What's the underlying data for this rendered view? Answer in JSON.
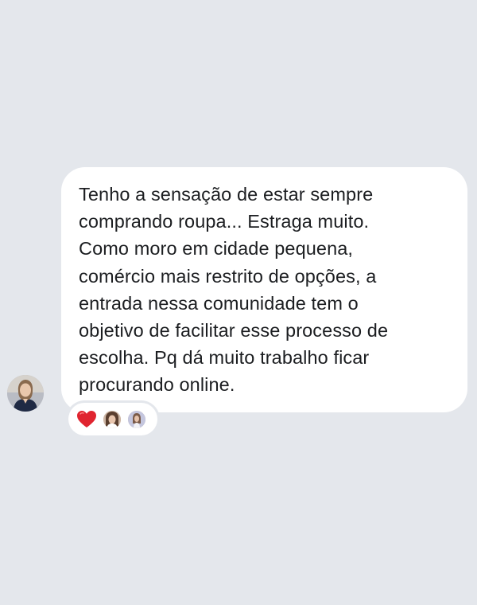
{
  "message": {
    "text": "Tenho a sensação de estar sempre\ncomprando roupa... Estraga muito.\nComo moro em cidade pequena,\ncomércio mais restrito de opções, a\nentrada nessa comunidade tem o\nobjetivo de facilitar esse processo de\nescolha. Pq dá muito trabalho ficar\nprocurando online."
  },
  "reactions": {
    "emoji_icon": "red-heart-icon",
    "reactor_count_shown": 2
  },
  "colors": {
    "background": "#e4e7ec",
    "bubble": "#ffffff",
    "text": "#1c1e21",
    "heart": "#e0242f"
  }
}
